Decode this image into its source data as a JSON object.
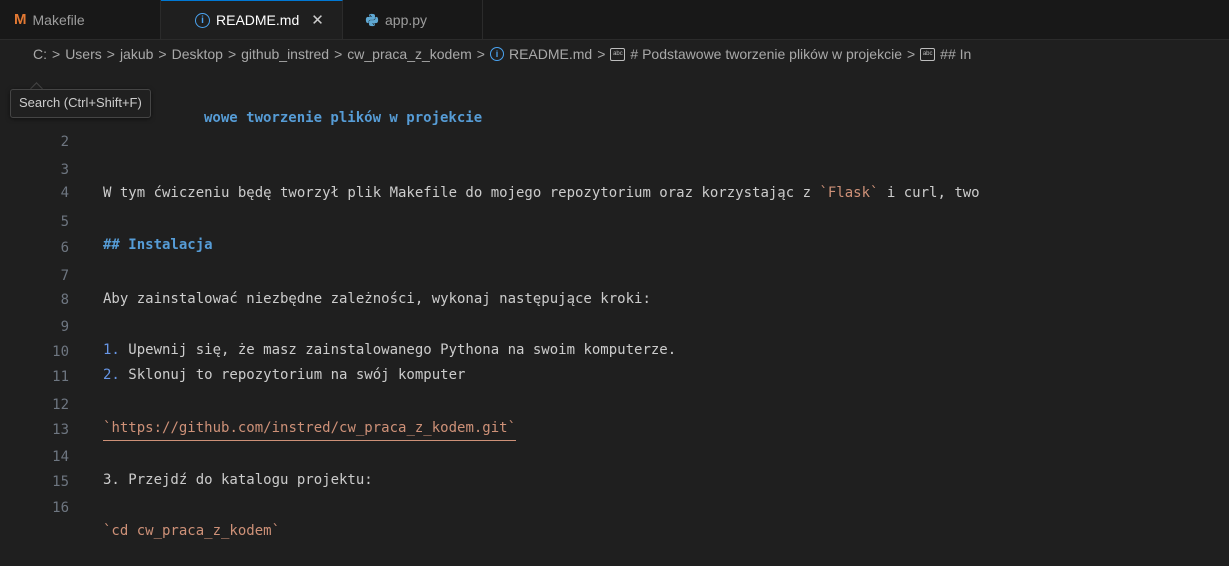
{
  "tabs": [
    {
      "label": "Makefile",
      "icon_text": "M",
      "icon": "makefile-icon",
      "active": false
    },
    {
      "label": "README.md",
      "icon": "info-icon",
      "active": true,
      "close_glyph": "✕"
    },
    {
      "label": "app.py",
      "icon": "python-icon",
      "active": false
    }
  ],
  "breadcrumb": {
    "items": [
      "C:",
      "Users",
      "jakub",
      "Desktop",
      "github_instred",
      "cw_praca_z_kodem",
      "README.md",
      "# Podstawowe tworzenie plików w projekcie",
      "## In"
    ],
    "separator": ">"
  },
  "tooltip": {
    "text": "Search (Ctrl+Shift+F)"
  },
  "editor": {
    "lines": [
      {
        "num": "",
        "heading_partial": "wowe tworzenie plików w projekcie"
      },
      {
        "num": "2",
        "text": ""
      },
      {
        "num": "3",
        "pre": "W tym ćwiczeniu będę tworzył plik Makefile do mojego repozytorium oraz korzystając z ",
        "code": "`Flask`",
        "post": " i curl, two"
      },
      {
        "num": "4",
        "text": ""
      },
      {
        "num": "5",
        "heading": "## Instalacja"
      },
      {
        "num": "6",
        "text": ""
      },
      {
        "num": "7",
        "text": "Aby zainstalować niezbędne zależności, wykonaj następujące kroki:"
      },
      {
        "num": "8",
        "text": ""
      },
      {
        "num": "9",
        "list_num": "1.",
        "text": " Upewnij się, że masz zainstalowanego Pythona na swoim komputerze."
      },
      {
        "num": "10",
        "list_num": "2.",
        "text": " Sklonuj to repozytorium na swój komputer"
      },
      {
        "num": "11",
        "text": ""
      },
      {
        "num": "12",
        "tick_open": "`",
        "link": "https://github.com/instred/cw_praca_z_kodem.git",
        "tick_close": "`"
      },
      {
        "num": "13",
        "text": ""
      },
      {
        "num": "14",
        "text": "3. Przejdź do katalogu projektu:"
      },
      {
        "num": "15",
        "text": ""
      },
      {
        "num": "16",
        "code": "`cd cw_praca_z_kodem`"
      }
    ]
  },
  "colors": {
    "background": "#1f1f1f",
    "heading": "#569cd6",
    "inline_code": "#ce9178",
    "line_number": "#6e7681",
    "accent": "#0078d4"
  }
}
